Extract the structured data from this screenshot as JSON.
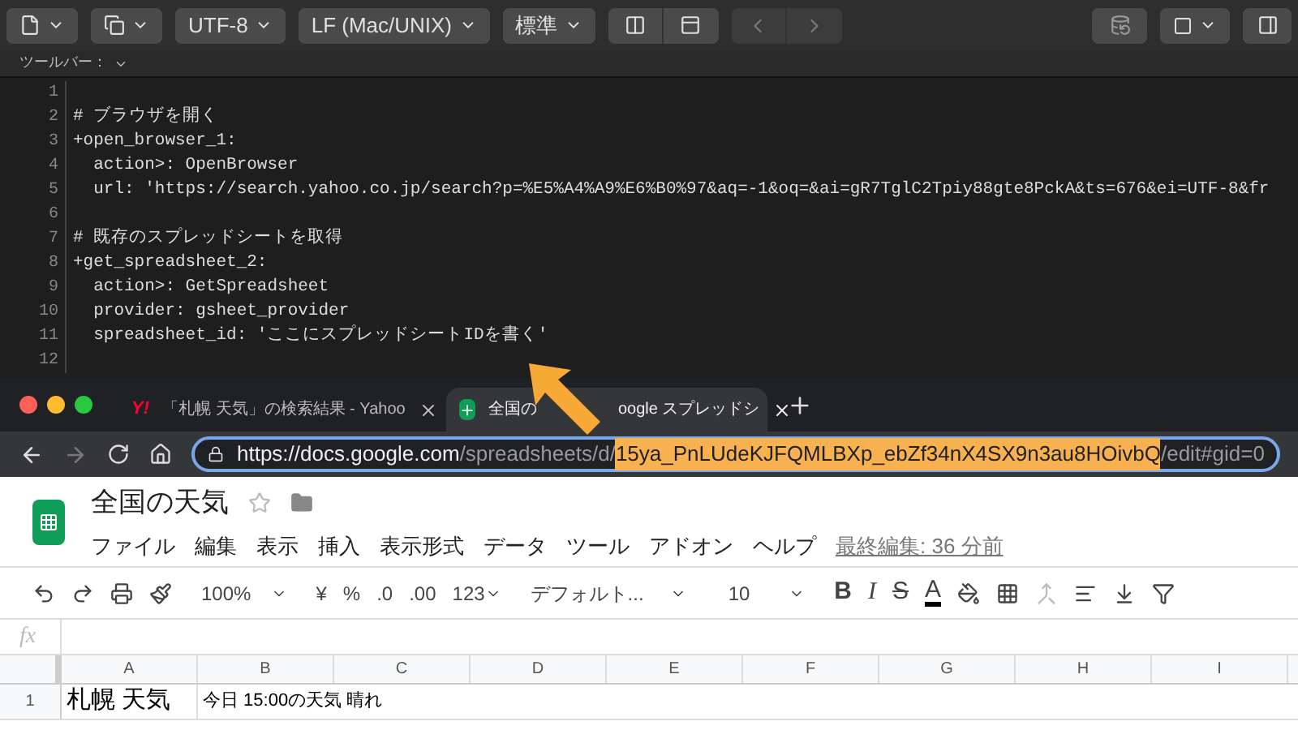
{
  "editor_toolbar": {
    "dropdowns": [
      "UTF-8",
      "LF (Mac/UNIX)",
      "標準"
    ],
    "label": "ツールバー："
  },
  "code_lines": [
    {
      "number": "1"
    },
    {
      "number": "2",
      "text": "# ブラウザを開く"
    },
    {
      "number": "3",
      "text": "+open_browser_1:"
    },
    {
      "number": "4",
      "text": "  action>: OpenBrowser"
    },
    {
      "number": "5",
      "text": "  url: 'https://search.yahoo.co.jp/search?p=%E5%A4%A9%E6%B0%97&aq=-1&oq=&ai=gR7TglC2Tpiy88gte8PckA&ts=676&ei=UTF-8&fr"
    },
    {
      "number": "6"
    },
    {
      "number": "7",
      "text": "# 既存のスプレッドシートを取得"
    },
    {
      "number": "8",
      "text": "+get_spreadsheet_2:"
    },
    {
      "number": "9",
      "text": "  action>: GetSpreadsheet"
    },
    {
      "number": "10",
      "text": "  provider: gsheet_provider"
    },
    {
      "number": "11",
      "text": "  spreadsheet_id: 'ここにスプレッドシートIDを書く'"
    },
    {
      "number": "12"
    }
  ],
  "browser": {
    "tabs": [
      {
        "kind": "yahoo",
        "logo": "Y!",
        "title_parts": [
          "「札幌 天気」の検索結果 - Yahoo"
        ],
        "selected": false
      },
      {
        "kind": "sheets",
        "title_parts": [
          "全国の",
          "oogle スプレッドシ"
        ],
        "selected": true
      }
    ],
    "url": {
      "host": "https://docs.google.com",
      "path": "/spreadsheets/d/",
      "highlighted": "15ya_PnLUdeKJFQMLBXp_ebZf34nX4SX9n3au8HOivbQ",
      "rest": "/edit#gid=0"
    }
  },
  "sheet": {
    "title": "全国の天気",
    "menu": [
      "ファイル",
      "編集",
      "表示",
      "挿入",
      "表示形式",
      "データ",
      "ツール",
      "アドオン",
      "ヘルプ"
    ],
    "last_edit": "最終編集: 36 分前",
    "toolbar": {
      "zoom": "100%",
      "currency": "¥",
      "percent": "%",
      "decrease_decimal": ".0",
      "increase_decimal": ".00",
      "number_format": "123",
      "font": "デフォルト...",
      "font_size": "10",
      "format_buttons": [
        "B",
        "I",
        "S",
        "A"
      ]
    },
    "formula_label": "fx",
    "columns": [
      "A",
      "B",
      "C",
      "D",
      "E",
      "F",
      "G",
      "H",
      "I"
    ],
    "rows": [
      {
        "number": "1",
        "cells": [
          "札幌 天気",
          "今日 15:00の天気 晴れ"
        ]
      }
    ]
  }
}
